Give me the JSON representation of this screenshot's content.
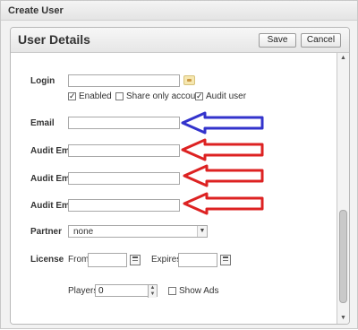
{
  "window": {
    "title": "Create User"
  },
  "panel": {
    "title": "User Details"
  },
  "buttons": {
    "save": "Save",
    "cancel": "Cancel"
  },
  "form": {
    "login_label": "Login",
    "enabled_label": "Enabled",
    "enabled_checked": true,
    "share_only_label": "Share only account",
    "share_only_checked": false,
    "audit_user_label": "Audit user",
    "audit_user_checked": true,
    "email_label": "Email",
    "audit_email_label_1": "Audit Email",
    "audit_email_label_2": "Audit Email",
    "audit_email_label_3": "Audit Email",
    "partner_label": "Partner",
    "partner_value": "none",
    "license_label": "License",
    "from_label": "From",
    "expires_label": "Expires",
    "players_label": "Players",
    "players_value": "0",
    "show_ads_label": "Show Ads",
    "show_ads_checked": false
  },
  "annotations": {
    "arrow_colors": [
      "#3333cc",
      "#dd2222",
      "#dd2222",
      "#dd2222"
    ]
  }
}
